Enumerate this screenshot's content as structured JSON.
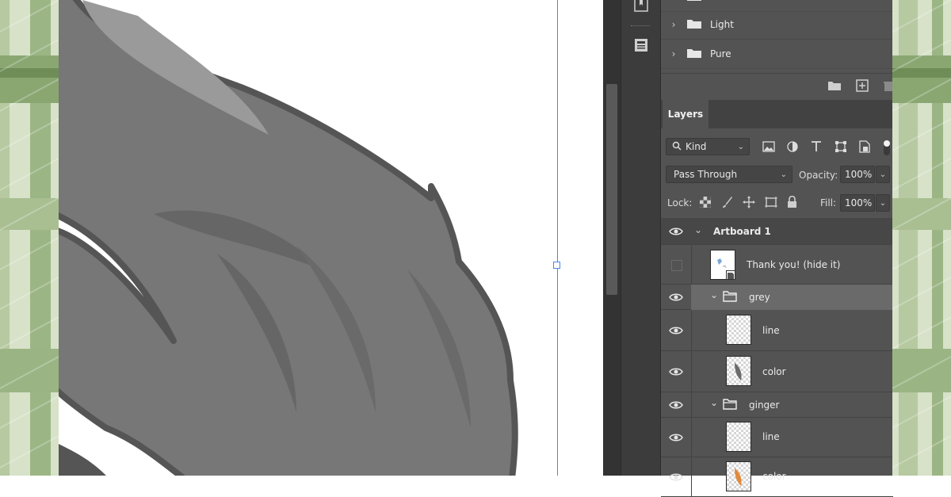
{
  "canvas": {
    "bg_color": "#ffffff",
    "guide_color": "#4a86e8",
    "artwork": "grey-fox-tail"
  },
  "background": {
    "pattern": "green-plaid",
    "colors": [
      "#b6c9a0",
      "#7f9c64",
      "#d7e2c9"
    ]
  },
  "sidebar_strip": {
    "icons": [
      "bookmark-icon",
      "document-icon"
    ]
  },
  "groups_panel": {
    "groups": [
      {
        "label": "Light"
      },
      {
        "label": "Pure"
      }
    ],
    "footer_icons": [
      "new-folder-icon",
      "add-icon",
      "delete-icon"
    ]
  },
  "layers_panel": {
    "tab_label": "Layers",
    "filter": {
      "kind_label": "Kind",
      "icons": [
        "image-filter-icon",
        "adjustment-filter-icon",
        "type-filter-icon",
        "shape-filter-icon",
        "smart-object-filter-icon"
      ]
    },
    "blend_mode": "Pass Through",
    "opacity_label": "Opacity:",
    "opacity_value": "100%",
    "lock_label": "Lock:",
    "fill_label": "Fill:",
    "fill_value": "100%",
    "layers": [
      {
        "name": "Artboard 1",
        "type": "artboard",
        "visible": true
      },
      {
        "name": "Thank you! (hide it)",
        "type": "smart-object",
        "visible": false
      },
      {
        "name": "grey",
        "type": "group",
        "visible": true,
        "selected": true
      },
      {
        "name": "line",
        "type": "layer",
        "visible": true
      },
      {
        "name": "color",
        "type": "layer",
        "visible": true
      },
      {
        "name": "ginger",
        "type": "group",
        "visible": true
      },
      {
        "name": "line",
        "type": "layer",
        "visible": true
      },
      {
        "name": "color",
        "type": "layer",
        "visible": true
      }
    ]
  },
  "colors": {
    "panel_bg": "#535353",
    "panel_dark": "#424242",
    "selected_row": "#6a6a6a",
    "text": "#eaeaea"
  }
}
